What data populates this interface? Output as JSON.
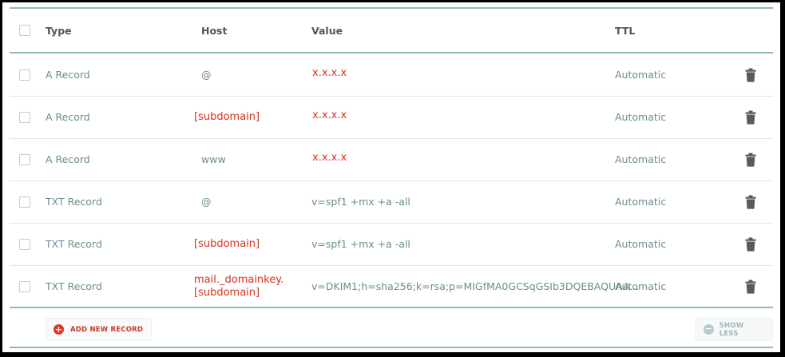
{
  "table": {
    "columns": {
      "type": "Type",
      "host": "Host",
      "value": "Value",
      "ttl": "TTL"
    },
    "rows": [
      {
        "type": "A Record",
        "host": "@",
        "host_highlight": false,
        "host2": "",
        "value": "x.x.x.x",
        "value_highlight": true,
        "ttl": "Automatic"
      },
      {
        "type": "A Record",
        "host": "[subdomain]",
        "host_highlight": true,
        "host2": "",
        "value": "x.x.x.x",
        "value_highlight": true,
        "ttl": "Automatic"
      },
      {
        "type": "A Record",
        "host": "www",
        "host_highlight": false,
        "host2": "",
        "value": "x.x.x.x",
        "value_highlight": true,
        "ttl": "Automatic"
      },
      {
        "type": "TXT Record",
        "host": "@",
        "host_highlight": false,
        "host2": "",
        "value": "v=spf1 +mx +a -all",
        "value_highlight": false,
        "ttl": "Automatic"
      },
      {
        "type": "TXT Record",
        "host": "[subdomain]",
        "host_highlight": true,
        "host2": "",
        "value": "v=spf1 +mx +a -all",
        "value_highlight": false,
        "ttl": "Automatic"
      },
      {
        "type": "TXT Record",
        "host": "mail._domainkey.",
        "host_highlight": true,
        "host2": "[subdomain]",
        "value": "v=DKIM1;h=sha256;k=rsa;p=MIGfMA0GCSqGSIb3DQEBAQUAA...",
        "value_highlight": false,
        "ttl": "Automatic"
      }
    ]
  },
  "actions": {
    "add_label": "ADD NEW RECORD",
    "show_less_label": "SHOW LESS"
  },
  "icons": {
    "delete": "trash-icon",
    "add": "plus-circle-icon",
    "collapse": "minus-circle-icon"
  },
  "colors": {
    "accent_line": "#8fb9bd",
    "highlight_red": "#d9301f",
    "text_teal": "#6b8d92"
  }
}
